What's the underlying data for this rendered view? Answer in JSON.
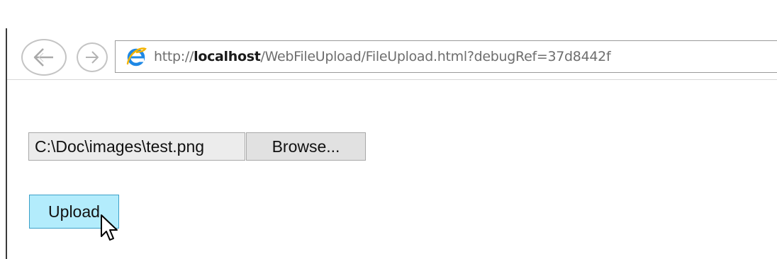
{
  "browser": {
    "url_prefix": "http://",
    "url_host": "localhost",
    "url_path": "/WebFileUpload/FileUpload.html?debugRef=37d8442f",
    "back_icon": "back-arrow-icon",
    "forward_icon": "forward-arrow-icon",
    "site_icon": "internet-explorer-icon"
  },
  "form": {
    "file_path_value": "C:\\Doc\\images\\test.png",
    "browse_label": "Browse...",
    "upload_label": "Upload"
  },
  "colors": {
    "upload_button_bg": "#b3ecfc",
    "upload_button_border": "#3ca0c8",
    "ie_blue": "#1e88e5"
  }
}
